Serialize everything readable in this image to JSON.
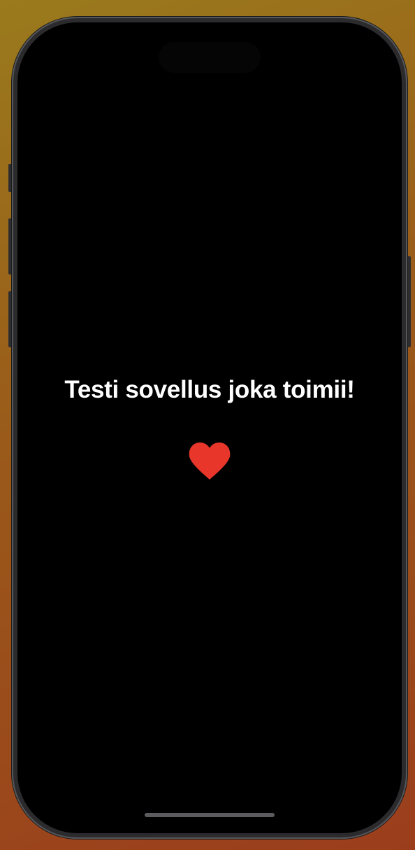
{
  "screen": {
    "headline": "Testi sovellus joka toimii!",
    "icon": "heart-icon",
    "icon_color": "#e8372a",
    "background_color": "#000000"
  }
}
